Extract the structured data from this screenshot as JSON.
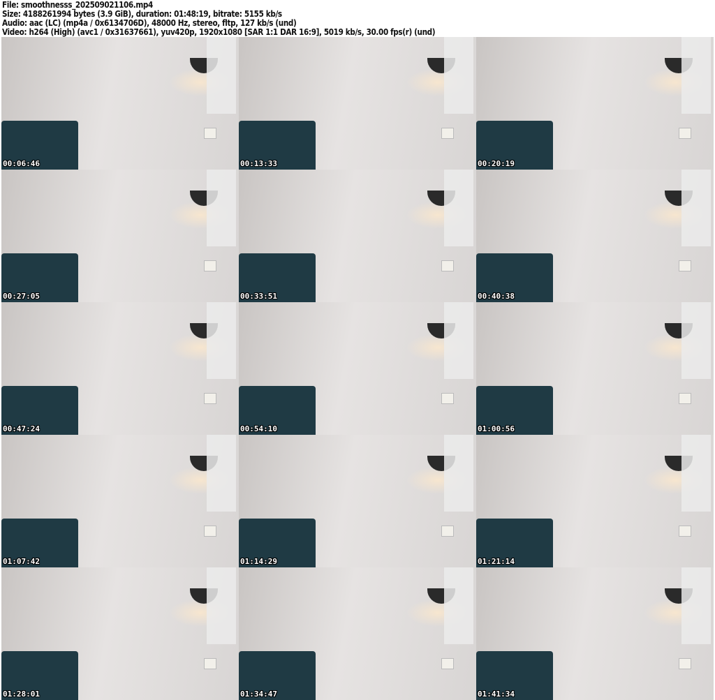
{
  "header": {
    "file": "File: smoothnesss_202509021106.mp4",
    "size": "Size: 4188261994 bytes (3.9 GiB), duration: 01:48:19, bitrate: 5155 kb/s",
    "audio": "Audio: aac (LC) (mp4a / 0x6134706D), 48000 Hz, stereo, fltp, 127 kb/s (und)",
    "video": "Video: h264 (High) (avc1 / 0x31637661), yuv420p, 1920x1080 [SAR 1:1 DAR 16:9], 5019 kb/s, 30.00 fps(r) (und)"
  },
  "thumbnails": [
    {
      "timestamp": "00:06:46"
    },
    {
      "timestamp": "00:13:33"
    },
    {
      "timestamp": "00:20:19"
    },
    {
      "timestamp": "00:27:05"
    },
    {
      "timestamp": "00:33:51"
    },
    {
      "timestamp": "00:40:38"
    },
    {
      "timestamp": "00:47:24"
    },
    {
      "timestamp": "00:54:10"
    },
    {
      "timestamp": "01:00:56"
    },
    {
      "timestamp": "01:07:42"
    },
    {
      "timestamp": "01:14:29"
    },
    {
      "timestamp": "01:21:14"
    },
    {
      "timestamp": "01:28:01"
    },
    {
      "timestamp": "01:34:47"
    },
    {
      "timestamp": "01:41:34"
    }
  ]
}
